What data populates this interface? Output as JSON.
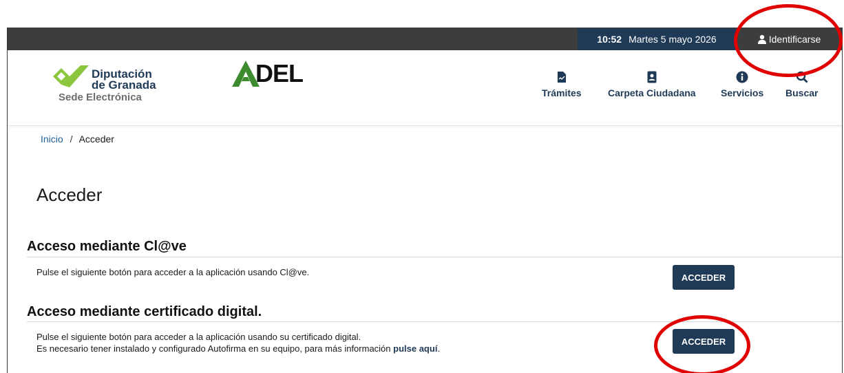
{
  "topbar": {
    "time": "10:52",
    "date": "Martes 5 mayo 2026",
    "login_label": "Identificarse"
  },
  "header": {
    "logo_name_line1": "Diputación",
    "logo_name_line2": "de Granada",
    "logo_subtitle": "Sede Electrónica",
    "adel_logo": "DEL",
    "nav": [
      {
        "label": "Trámites",
        "icon": "document-icon"
      },
      {
        "label": "Carpeta Ciudadana",
        "icon": "id-card-icon"
      },
      {
        "label": "Servicios",
        "icon": "info-icon"
      },
      {
        "label": "Buscar",
        "icon": "search-icon"
      }
    ]
  },
  "breadcrumb": {
    "home": "Inicio",
    "separator": "/",
    "current": "Acceder"
  },
  "page_title": "Acceder",
  "sections": [
    {
      "title": "Acceso mediante Cl@ve",
      "text": "Pulse el siguiente botón para acceder a la aplicación usando Cl@ve.",
      "button": "ACCEDER"
    },
    {
      "title": "Acceso mediante certificado digital.",
      "text": "Pulse el siguiente botón para acceder a la aplicación usando su certificado digital.",
      "text2_prefix": "Es necesario tener instalado y configurado Autofirma en su equipo, para más información ",
      "text2_link": "pulse aquí",
      "text2_suffix": ".",
      "button": "ACCEDER"
    }
  ],
  "colors": {
    "brand": "#1f3a56",
    "topbar": "#3d3d3d",
    "annotation": "#e00000",
    "logo_green": "#8cc63f"
  }
}
